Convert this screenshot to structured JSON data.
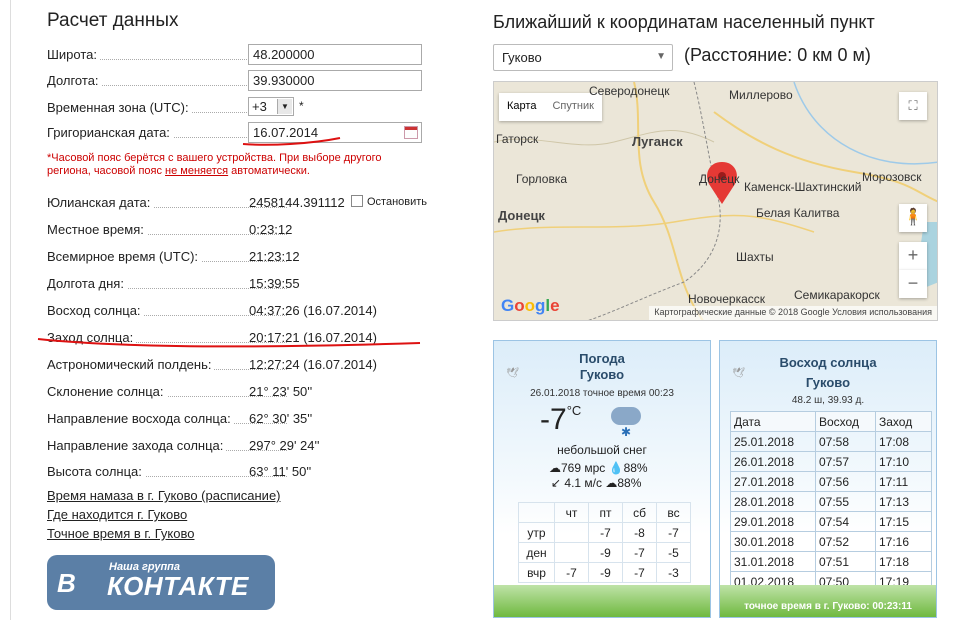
{
  "left": {
    "title": "Расчет данных",
    "latitude_label": "Широта:",
    "latitude_value": "48.200000",
    "longitude_label": "Долгота:",
    "longitude_value": "39.930000",
    "timezone_label": "Временная зона (UTC):",
    "timezone_value": "+3",
    "timezone_star": "*",
    "gregorian_label": "Григорианская дата:",
    "gregorian_value": "16.07.2014",
    "note_part1": "*Часовой пояс берётся с вашего устройства. При выборе другого региона, часовой пояс ",
    "note_link": "не меняется",
    "note_part2": " автоматически.",
    "julian_label": "Юлианская дата:",
    "julian_value": "2458144.391112",
    "stop_label": "Остановить",
    "local_time_label": "Местное время:",
    "local_time_value": "0:23:12",
    "utc_label": "Всемирное время (UTC):",
    "utc_value": "21:23:12",
    "day_length_label": "Долгота дня:",
    "day_length_value": "15:39:55",
    "sunrise_label": "Восход солнца:",
    "sunrise_value": "04:37:26  (16.07.2014)",
    "sunset_label": "Заход солнца:",
    "sunset_value": "20:17:21  (16.07.2014)",
    "noon_label": "Астрономический полдень:",
    "noon_value": "12:27:24  (16.07.2014)",
    "declination_label": "Склонение солнца:",
    "declination_value": "21° 23' 50''",
    "sunrise_dir_label": "Направление восхода солнца:",
    "sunrise_dir_value": "62° 30' 35''",
    "sunset_dir_label": "Направление захода солнца:",
    "sunset_dir_value": "297° 29' 24''",
    "altitude_label": "Высота солнца:",
    "altitude_value": "63° 11' 50''",
    "links": [
      "Время намаза в г. Гуково (расписание)",
      "Где находится г. Гуково",
      "Точное время в г. Гуково"
    ],
    "vk_small": "Наша группа",
    "vk_big": "КОНТАКТЕ",
    "vk_logo": "В"
  },
  "right": {
    "title": "Ближайший к координатам населенный пункт",
    "place_value": "Гуково",
    "distance": "(Расстояние: 0 км 0 м)",
    "map": {
      "tab_map": "Карта",
      "tab_satellite": "Спутник",
      "labels": [
        "Северодонецк",
        "Миллерово",
        "Луганск",
        "Горловка",
        "Донецк",
        "Каменск-Шахтинский",
        "Морозовск",
        "Белая Калитва",
        "Шахты",
        "Новочеркасск",
        "Семикаракорск",
        "Гаторск",
        "Донецк"
      ],
      "google": "Google",
      "footer": "Картографические данные © 2018 Google     Условия использования",
      "zoom_in": "+",
      "zoom_out": "−"
    },
    "weather": {
      "title": "Погода",
      "city": "Гуково",
      "date_line": "26.01.2018 точное время 00:23",
      "temp": "-7",
      "temp_unit": "°C",
      "desc": "небольшой снег",
      "pressure": "769 мрс",
      "humidity": "88%",
      "wind": "4.1 м/с",
      "cloud": "88%",
      "days": [
        "чт",
        "пт",
        "сб",
        "вс"
      ],
      "rows": [
        {
          "label": "утр",
          "vals": [
            "",
            "-7",
            "-8",
            "-7"
          ]
        },
        {
          "label": "ден",
          "vals": [
            "",
            "-9",
            "-7",
            "-5"
          ]
        },
        {
          "label": "вчр",
          "vals": [
            "-7",
            "-9",
            "-7",
            "-3"
          ]
        }
      ]
    },
    "sun": {
      "title": "Восход солнца",
      "city": "Гуково",
      "coords": "48.2 ш, 39.93 д.",
      "headers": [
        "Дата",
        "Восход",
        "Заход"
      ],
      "rows": [
        [
          "25.01.2018",
          "07:58",
          "17:08"
        ],
        [
          "26.01.2018",
          "07:57",
          "17:10"
        ],
        [
          "27.01.2018",
          "07:56",
          "17:11"
        ],
        [
          "28.01.2018",
          "07:55",
          "17:13"
        ],
        [
          "29.01.2018",
          "07:54",
          "17:15"
        ],
        [
          "30.01.2018",
          "07:52",
          "17:16"
        ],
        [
          "31.01.2018",
          "07:51",
          "17:18"
        ],
        [
          "01.02.2018",
          "07:50",
          "17:19"
        ]
      ],
      "footer": "точное время в г. Гуково: 00:23:11"
    }
  }
}
